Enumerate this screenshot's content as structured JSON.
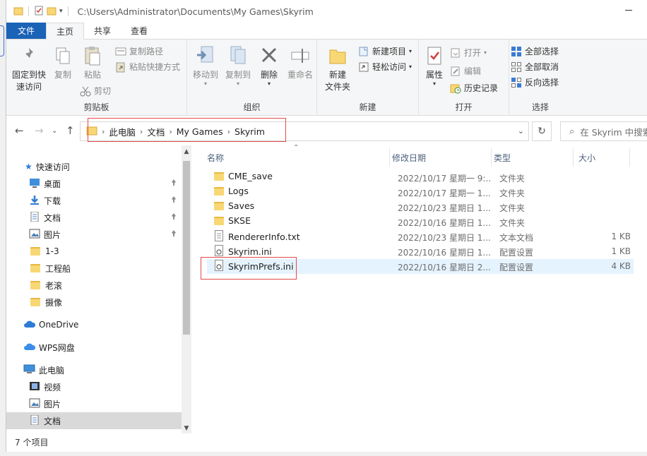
{
  "window": {
    "title_path": "C:\\Users\\Administrator\\Documents\\My Games\\Skyrim"
  },
  "ribbon_tabs": [
    {
      "label": "文件"
    },
    {
      "label": "主页"
    },
    {
      "label": "共享"
    },
    {
      "label": "查看"
    }
  ],
  "ribbon": {
    "clipboard": {
      "group_label": "剪贴板",
      "pin_label": "固定到快\n速访问",
      "copy_label": "复制",
      "paste_label": "粘贴",
      "copy_path_label": "复制路径",
      "paste_shortcut_label": "粘贴快捷方式",
      "cut_label": "剪切"
    },
    "organize": {
      "group_label": "组织",
      "move_to_label": "移动到",
      "copy_to_label": "复制到",
      "delete_label": "删除",
      "rename_label": "重命名"
    },
    "new": {
      "group_label": "新建",
      "new_folder_label": "新建\n文件夹",
      "new_item_label": "新建项目",
      "easy_access_label": "轻松访问"
    },
    "open": {
      "group_label": "打开",
      "properties_label": "属性",
      "open_label": "打开",
      "edit_label": "编辑",
      "history_label": "历史记录"
    },
    "select": {
      "group_label": "选择",
      "select_all_label": "全部选择",
      "select_none_label": "全部取消",
      "invert_label": "反向选择"
    }
  },
  "address": {
    "crumbs": [
      "此电脑",
      "文档",
      "My Games",
      "Skyrim"
    ],
    "search_placeholder": "在 Skyrim 中搜索"
  },
  "nav_pane": {
    "items": [
      {
        "label": "快速访问",
        "icon": "star-icon"
      },
      {
        "label": "桌面",
        "icon": "desktop-icon",
        "pinned": true
      },
      {
        "label": "下载",
        "icon": "download-icon",
        "pinned": true
      },
      {
        "label": "文档",
        "icon": "document-icon",
        "pinned": true
      },
      {
        "label": "图片",
        "icon": "picture-icon",
        "pinned": true
      },
      {
        "label": "1-3",
        "icon": "folder-icon"
      },
      {
        "label": "工程船",
        "icon": "folder-icon"
      },
      {
        "label": "老滚",
        "icon": "folder-icon"
      },
      {
        "label": "摄像",
        "icon": "folder-icon"
      },
      {
        "label": "OneDrive",
        "icon": "cloud-icon"
      },
      {
        "label": "WPS网盘",
        "icon": "cloud-icon"
      },
      {
        "label": "此电脑",
        "icon": "computer-icon"
      },
      {
        "label": "视频",
        "icon": "video-icon"
      },
      {
        "label": "图片",
        "icon": "picture-icon"
      },
      {
        "label": "文档",
        "icon": "document-icon"
      }
    ]
  },
  "file_list": {
    "columns": {
      "name": "名称",
      "date": "修改日期",
      "type": "类型",
      "size": "大小"
    },
    "rows": [
      {
        "name": "CME_save",
        "date": "2022/10/17 星期一 9:...",
        "type": "文件夹",
        "size": "",
        "icon": "folder-icon"
      },
      {
        "name": "Logs",
        "date": "2022/10/17 星期一 1...",
        "type": "文件夹",
        "size": "",
        "icon": "folder-icon"
      },
      {
        "name": "Saves",
        "date": "2022/10/23 星期日 1...",
        "type": "文件夹",
        "size": "",
        "icon": "folder-icon"
      },
      {
        "name": "SKSE",
        "date": "2022/10/16 星期日 1...",
        "type": "文件夹",
        "size": "",
        "icon": "folder-icon"
      },
      {
        "name": "RendererInfo.txt",
        "date": "2022/10/23 星期日 1...",
        "type": "文本文档",
        "size": "1 KB",
        "icon": "text-file-icon"
      },
      {
        "name": "Skyrim.ini",
        "date": "2022/10/16 星期日 1...",
        "type": "配置设置",
        "size": "1 KB",
        "icon": "ini-file-icon"
      },
      {
        "name": "SkyrimPrefs.ini",
        "date": "2022/10/16 星期日 2...",
        "type": "配置设置",
        "size": "4 KB",
        "icon": "ini-file-icon"
      }
    ]
  },
  "status": {
    "item_count": "7 个项目"
  },
  "colors": {
    "accent": "#1a63b7",
    "selection": "#e5f3ff",
    "highlight_box": "#e24a4a",
    "folder": "#f8d775"
  }
}
